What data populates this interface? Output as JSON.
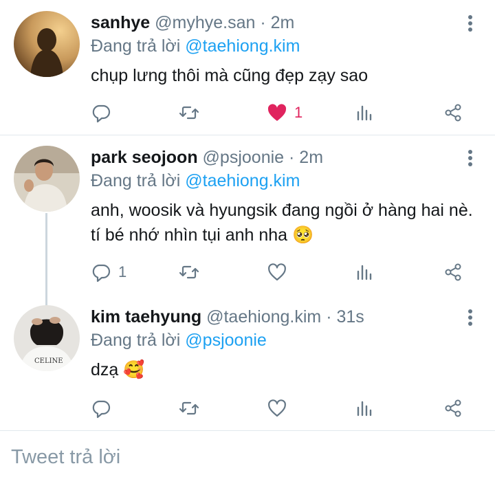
{
  "tweets": [
    {
      "name": "sanhye",
      "handle": "@myhye.san",
      "separator": "·",
      "time": "2m",
      "replying_prefix": "Đang trả lời",
      "replying_to": "@taehiong.kim",
      "text": "chụp lưng thôi mà cũng đẹp zạy sao",
      "reply_count": "",
      "like_count": "1",
      "liked": true
    },
    {
      "name": "park seojoon",
      "handle": "@psjoonie",
      "separator": "·",
      "time": "2m",
      "replying_prefix": "Đang trả lời",
      "replying_to": "@taehiong.kim",
      "text": "anh, woosik và hyungsik đang ngồi ở hàng hai nè. tí bé nhớ nhìn tụi anh nha 🥺",
      "reply_count": "1",
      "like_count": "",
      "liked": false
    },
    {
      "name": "kim taehyung",
      "handle": "@taehiong.kim",
      "separator": "·",
      "time": "31s",
      "replying_prefix": "Đang trả lời",
      "replying_to": "@psjoonie",
      "text": "dzạ 🥰",
      "reply_count": "",
      "like_count": "",
      "liked": false
    }
  ],
  "reply_box": {
    "placeholder": "Tweet trả lời"
  },
  "icons": {
    "reply": "reply-icon",
    "retweet": "retweet-icon",
    "like": "heart-icon",
    "analytics": "analytics-icon",
    "share": "share-icon",
    "more": "more-vertical-icon"
  },
  "colors": {
    "mention": "#1da1f2",
    "secondary_text": "#657786",
    "like_active": "#e0245e",
    "divider": "#e1e8ed"
  }
}
